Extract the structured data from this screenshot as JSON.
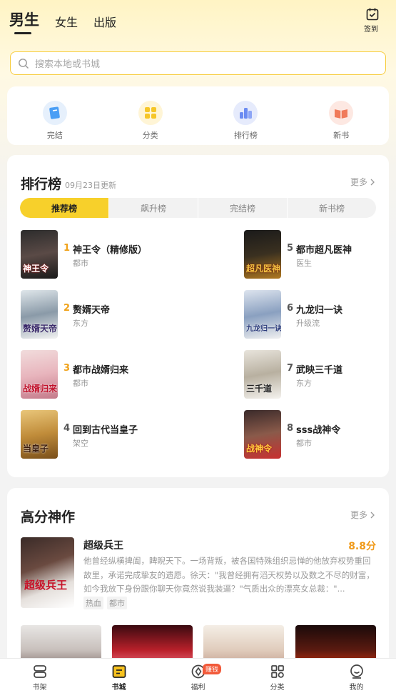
{
  "header": {
    "tabs": [
      {
        "label": "男生",
        "active": true
      },
      {
        "label": "女生",
        "active": false
      },
      {
        "label": "出版",
        "active": false
      }
    ],
    "checkin_label": "签到"
  },
  "search": {
    "placeholder": "搜索本地或书城"
  },
  "quick_links": [
    {
      "label": "完结",
      "icon": "book-icon",
      "color": "#4a9ef5"
    },
    {
      "label": "分类",
      "icon": "grid-icon",
      "color": "#f6c628"
    },
    {
      "label": "排行榜",
      "icon": "bar-chart-icon",
      "color": "#6c8cf2"
    },
    {
      "label": "新书",
      "icon": "open-book-icon",
      "color": "#f07a5a"
    }
  ],
  "ranking": {
    "title": "排行榜",
    "updated": "09月23日更新",
    "more": "更多",
    "tabs": [
      "推荐榜",
      "飙升榜",
      "完结榜",
      "新书榜"
    ],
    "active_tab": "推荐榜",
    "items": [
      {
        "rank": "1",
        "name": "神王令（精修版）",
        "tag": "都市",
        "cover_text": "神王令"
      },
      {
        "rank": "2",
        "name": "赘婿天帝",
        "tag": "东方",
        "cover_text": "赘婿天帝"
      },
      {
        "rank": "3",
        "name": "都市战婿归来",
        "tag": "都市",
        "cover_text": "战婿归来"
      },
      {
        "rank": "4",
        "name": "回到古代当皇子",
        "tag": "架空",
        "cover_text": "当皇子"
      },
      {
        "rank": "5",
        "name": "都市超凡医神",
        "tag": "医生",
        "cover_text": "超凡医神"
      },
      {
        "rank": "6",
        "name": "九龙归一诀",
        "tag": "升级流",
        "cover_text": "九龙归一诀"
      },
      {
        "rank": "7",
        "name": "武映三千道",
        "tag": "东方",
        "cover_text": "三千道"
      },
      {
        "rank": "8",
        "name": "sss战神令",
        "tag": "都市",
        "cover_text": "战神令"
      }
    ]
  },
  "high_score": {
    "title": "高分神作",
    "more": "更多",
    "featured": {
      "name": "超级兵王",
      "score": "8.8分",
      "cover_text": "超级兵王",
      "desc": "他曾经纵横捭阖，睥睨天下。一场背叛，被各国特殊组织忌惮的他放弃权势重回故里，承诺完成挚友的遗愿。徐天：\"我曾经拥有滔天权势以及数之不尽的财富，如今我放下身份跟你聊天你竟然说我装逼？\"气质出众的漂亮女总裁：\"...",
      "tags": [
        "热血",
        "都市"
      ]
    }
  },
  "bottom_nav": [
    {
      "label": "书架",
      "icon": "bookshelf-icon",
      "active": false
    },
    {
      "label": "书城",
      "icon": "bookstore-icon",
      "active": true
    },
    {
      "label": "福利",
      "icon": "gift-icon",
      "active": false,
      "badge": "赚钱"
    },
    {
      "label": "分类",
      "icon": "category-icon",
      "active": false
    },
    {
      "label": "我的",
      "icon": "profile-icon",
      "active": false
    }
  ],
  "colors": {
    "accent": "#f7d02b",
    "rank_top": "#f0a21a",
    "rank_other": "#555555",
    "score": "#f09a1a",
    "badge": "#f25a3a"
  }
}
